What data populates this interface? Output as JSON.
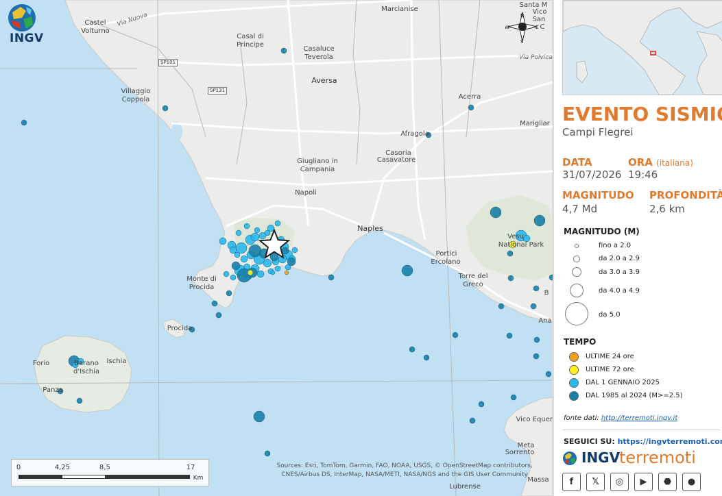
{
  "map": {
    "logo_text": "INGV",
    "compass": {
      "n": "N",
      "s": "S",
      "e": "E",
      "w": "W"
    },
    "places": [
      {
        "name": "Marcianise",
        "cls": ""
      },
      {
        "name": "Santa M",
        "cls": ""
      },
      {
        "name": "Vico",
        "cls": ""
      },
      {
        "name": "San",
        "cls": ""
      },
      {
        "name": "C",
        "cls": ""
      },
      {
        "name": "Castel\nVolturno",
        "cls": ""
      },
      {
        "name": "Casal di\nPrincipe",
        "cls": ""
      },
      {
        "name": "Casaluce\nTeverola",
        "cls": ""
      },
      {
        "name": "Aversa",
        "cls": "big"
      },
      {
        "name": "Villaggio\nCoppola",
        "cls": ""
      },
      {
        "name": "Acerra",
        "cls": ""
      },
      {
        "name": "Afragola",
        "cls": ""
      },
      {
        "name": "Marigliar",
        "cls": ""
      },
      {
        "name": "Casoria",
        "cls": ""
      },
      {
        "name": "Casavatore",
        "cls": ""
      },
      {
        "name": "Giugliano in\nCampania",
        "cls": ""
      },
      {
        "name": "Napoli",
        "cls": ""
      },
      {
        "name": "Naples",
        "cls": "big"
      },
      {
        "name": "Portici",
        "cls": ""
      },
      {
        "name": "Ercolano",
        "cls": ""
      },
      {
        "name": "Torre del\nGreco",
        "cls": ""
      },
      {
        "name": "Monte di\nProcida",
        "cls": ""
      },
      {
        "name": "Procida",
        "cls": ""
      },
      {
        "name": "Forio",
        "cls": ""
      },
      {
        "name": "Ischia",
        "cls": ""
      },
      {
        "name": "Barano\nd'Ischia",
        "cls": ""
      },
      {
        "name": "Panza",
        "cls": ""
      },
      {
        "name": "Vesu",
        "cls": ""
      },
      {
        "name": "National Park",
        "cls": ""
      },
      {
        "name": "Vico Equens",
        "cls": ""
      },
      {
        "name": "Sorrento",
        "cls": ""
      },
      {
        "name": "Massa",
        "cls": ""
      },
      {
        "name": "Lubrense",
        "cls": ""
      },
      {
        "name": "Meta",
        "cls": ""
      },
      {
        "name": "Ana",
        "cls": ""
      },
      {
        "name": "B",
        "cls": ""
      }
    ],
    "roads": [
      {
        "name": "Via Nuova"
      },
      {
        "name": "Via Polvica"
      }
    ],
    "road_tags": [
      "SP101",
      "SP131"
    ],
    "scale_labels": [
      "0",
      "4,25",
      "8,5",
      "17"
    ],
    "scale_unit": "Km",
    "attribution": "Sources: Esri, TomTom, Garmin, FAO, NOAA, USGS, © OpenStreetMap contributors, CNES/Airbus DS, InterMap, NASA/METI, NASA/NGS and the GIS User Community",
    "colors": {
      "sea": "#c2e0f4",
      "land": "#ececea",
      "road": "#ffffff",
      "event": "#2aa3dd",
      "historic": "#1a7fa8",
      "last72": "#ffee22",
      "last24": "#f0a020"
    }
  },
  "panel": {
    "title": "EVENTO SISMICO",
    "subtitle": "Campi Flegrei",
    "date_label": "DATA",
    "date_value": "31/07/2026",
    "time_label": "ORA",
    "time_note": "(italiana)",
    "time_value": "19:46",
    "mag_label": "MAGNITUDO",
    "mag_value": "4,7 Md",
    "depth_label": "PROFONDITÀ",
    "depth_value": "2,6 km",
    "legend_mag_title": "MAGNITUDO (M)",
    "legend_mag": [
      "fino a 2.0",
      "da 2.0 a 2.9",
      "da 3.0 a 3.9",
      "da 4.0 a 4.9",
      "da 5.0"
    ],
    "legend_time_title": "TEMPO",
    "legend_time": [
      {
        "label": "ULTIME 24 ore",
        "color": "#f0a020"
      },
      {
        "label": "ULTIME 72 ore",
        "color": "#ffee22"
      },
      {
        "label": "DAL 1 GENNAIO 2025",
        "color": "#2ab8ec"
      },
      {
        "label": "DAL 1985 al 2024 (M>=2.5)",
        "color": "#1a7fa8"
      }
    ],
    "source_label": "fonte dati:",
    "source_url": "http://terremoti.ingv.it",
    "follow_label": "SEGUICI SU:",
    "follow_url": "https://ingvterremoti.com",
    "brand_a": "INGV",
    "brand_b": "terremoti",
    "socials": [
      "facebook-icon",
      "x-icon",
      "instagram-icon",
      "youtube-icon",
      "android-icon",
      "apple-icon"
    ]
  }
}
